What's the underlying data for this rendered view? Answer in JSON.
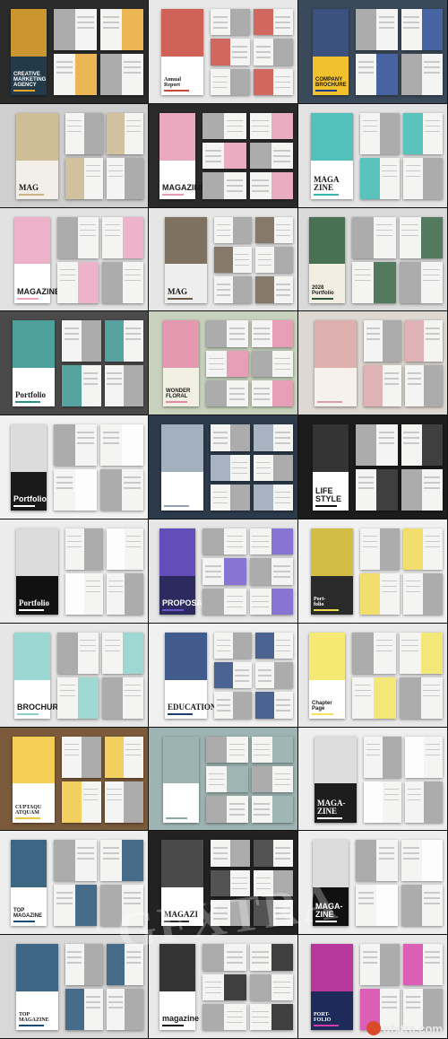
{
  "tiles": [
    {
      "title": "CREATIVE\nMARKETING\nAGENCY",
      "cover_color": "#223a4a",
      "accent": "#e9a62b",
      "bg": "#2b2b2b"
    },
    {
      "title": "Annual\nReport",
      "cover_color": "#ffffff",
      "accent": "#c8453a",
      "bg": "#e7e7e7"
    },
    {
      "title": "COMPANY\nBROCHURE",
      "cover_color": "#f2c12e",
      "accent": "#1c3e8c",
      "bg": "#3a4a5a"
    },
    {
      "title": "MAG",
      "cover_color": "#f2efe8",
      "accent": "#c9b48a",
      "bg": "#cfcfcf"
    },
    {
      "title": "MAGAZINE",
      "cover_color": "#ffffff",
      "accent": "#e79ab4",
      "bg": "#2a2a2a"
    },
    {
      "title": "MAGA\nZINE",
      "cover_color": "#ffffff",
      "accent": "#34b6b0",
      "bg": "#e3e3e3"
    },
    {
      "title": "MAGAZINE",
      "cover_color": "#ffffff",
      "accent": "#eba3c1",
      "bg": "#e2e2e2"
    },
    {
      "title": "MAG",
      "cover_color": "#eeeeee",
      "accent": "#6a5a46",
      "bg": "#e6e6e6"
    },
    {
      "title": "2028\nPortfolio",
      "cover_color": "#f2efe2",
      "accent": "#2a5a3a",
      "bg": "#dadada"
    },
    {
      "title": "Portfolio",
      "cover_color": "#ffffff",
      "accent": "#2e8f8a",
      "bg": "#4a4a4a"
    },
    {
      "title": "WONDER\nFLORAL",
      "cover_color": "#f1f0e2",
      "accent": "#e38aa7",
      "bg": "#c7d1bd"
    },
    {
      "title": "",
      "cover_color": "#f6f1ec",
      "accent": "#d9a3a5",
      "bg": "#ded8d2"
    },
    {
      "title": "Portfolio",
      "cover_color": "#1a1a1a",
      "accent": "#ffffff",
      "bg": "#f1f1f1"
    },
    {
      "title": "",
      "cover_color": "#ffffff",
      "accent": "#93a3b4",
      "bg": "#2c3b4c"
    },
    {
      "title": "LIFE STYLE",
      "cover_color": "#ffffff",
      "accent": "#111111",
      "bg": "#1c1c1c"
    },
    {
      "title": "Portfolio",
      "cover_color": "#111111",
      "accent": "#ffffff",
      "bg": "#ececec"
    },
    {
      "title": "PROPOSAL",
      "cover_color": "#2c2a5e",
      "accent": "#6d54c9",
      "bg": "#e6e6e6"
    },
    {
      "title": "Port-\nfolio",
      "cover_color": "#2a2a2a",
      "accent": "#f1d84a",
      "bg": "#f1f1f1"
    },
    {
      "title": "BROCHURE",
      "cover_color": "#ffffff",
      "accent": "#8ad0cb",
      "bg": "#e6e6e6"
    },
    {
      "title": "EDUCATION",
      "cover_color": "#ffffff",
      "accent": "#1f3e78",
      "bg": "#f0f0f0"
    },
    {
      "title": "Chapter\nPage",
      "cover_color": "#ffffff",
      "accent": "#f3e45a",
      "bg": "#e8e8e8"
    },
    {
      "title": "CUPTAQU ATQUAM",
      "cover_color": "#ffffff",
      "accent": "#f2c53a",
      "bg": "#7a5a3a"
    },
    {
      "title": "",
      "cover_color": "#ffffff",
      "accent": "#8aa7a4",
      "bg": "#9eb4b2"
    },
    {
      "title": "MAGA-ZINE",
      "cover_color": "#1d1d1d",
      "accent": "#ffffff",
      "bg": "#eeeeee"
    },
    {
      "title": "TOP\nMAGAZINE",
      "cover_color": "#ffffff",
      "accent": "#1b4a6e",
      "bg": "#eeeeee"
    },
    {
      "title": "MAGAZI",
      "cover_color": "#ffffff",
      "accent": "#2a2a2a",
      "bg": "#222222"
    },
    {
      "title": "MAGA-ZINE",
      "cover_color": "#111111",
      "accent": "#ffffff",
      "bg": "#eeeeee"
    },
    {
      "title": "TOP\nMAGAZINE",
      "cover_color": "#ffffff",
      "accent": "#1b4a6e",
      "bg": "#d8d8d8"
    },
    {
      "title": "magazine",
      "cover_color": "#ffffff",
      "accent": "#111111",
      "bg": "#e8e8e8"
    },
    {
      "title": "PORT-\nFOLIO",
      "cover_color": "#1e2a5a",
      "accent": "#d43aa8",
      "bg": "#e9e9e9"
    }
  ],
  "watermark": "GFXTRA",
  "footer": {
    "site": "gfxtra.com"
  }
}
